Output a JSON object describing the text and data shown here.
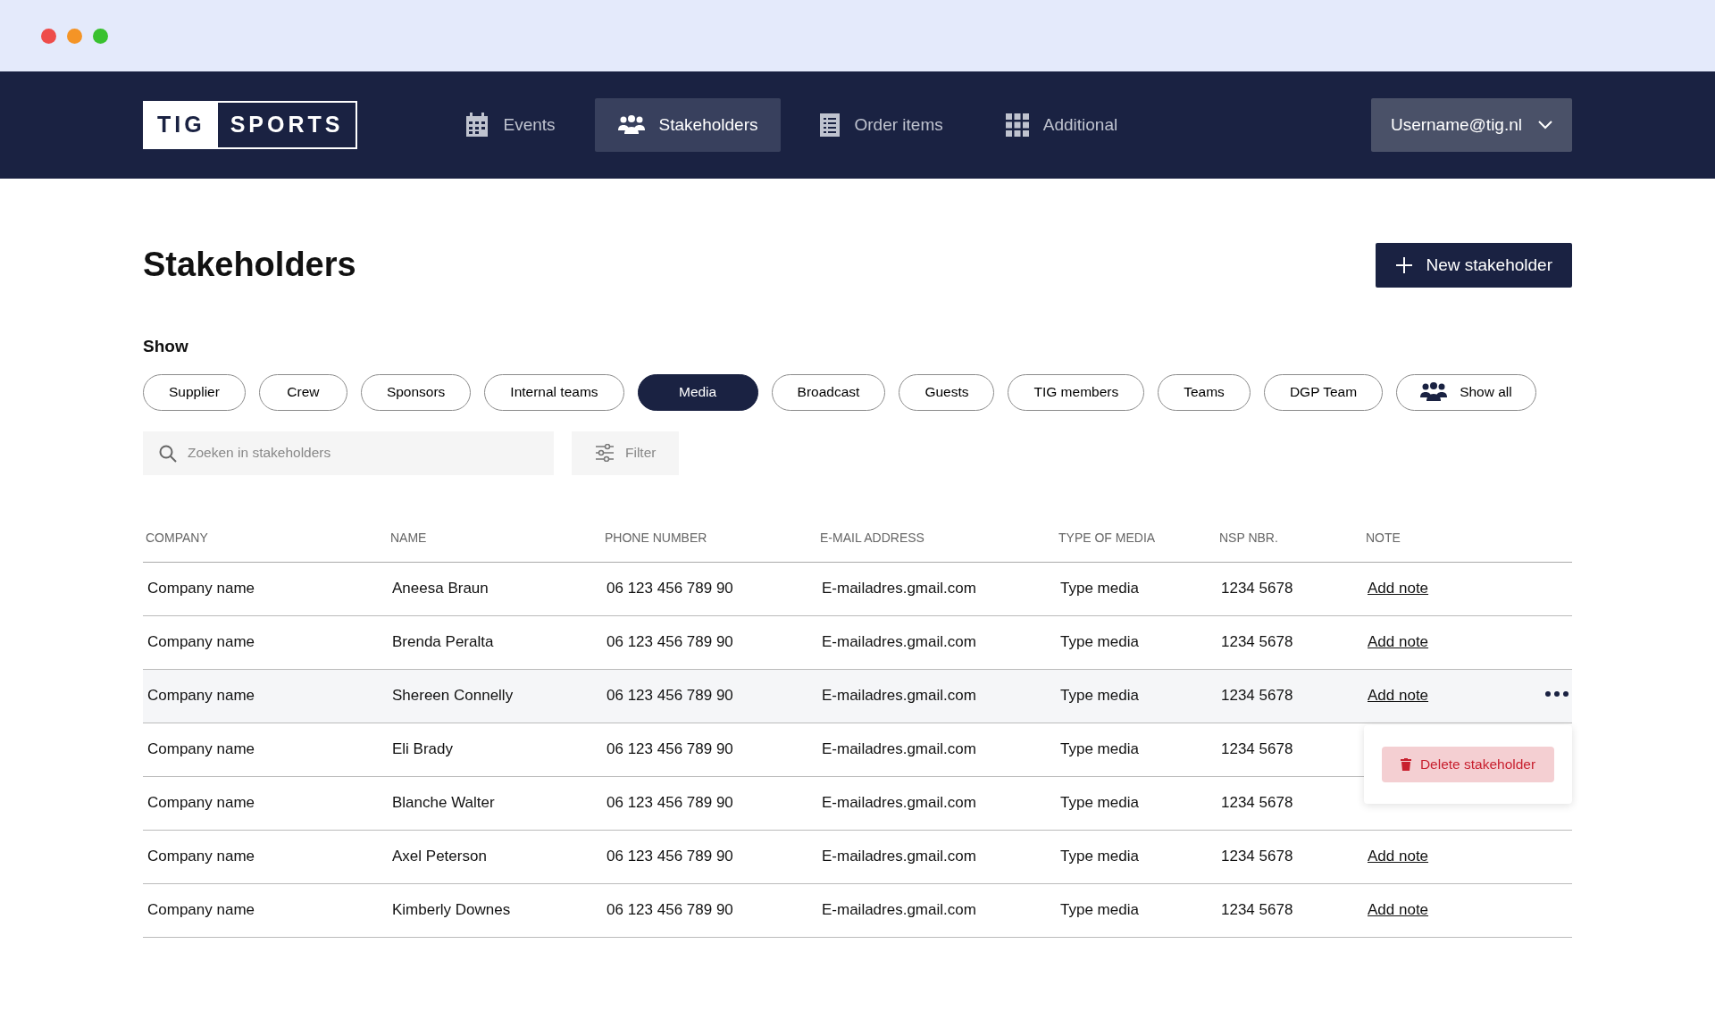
{
  "navbar": {
    "logo": [
      "TIG",
      "SPORTS"
    ],
    "items": [
      {
        "label": "Events",
        "selected": false
      },
      {
        "label": "Stakeholders",
        "selected": true
      },
      {
        "label": "Order items",
        "selected": false
      },
      {
        "label": "Additional",
        "selected": false
      }
    ],
    "user": "Username@tig.nl"
  },
  "page": {
    "title": "Stakeholders",
    "new_button": "New stakeholder"
  },
  "filters": {
    "label": "Show",
    "chips": [
      {
        "label": "Supplier",
        "selected": false,
        "kind": "plain"
      },
      {
        "label": "Crew",
        "selected": false,
        "kind": "plain"
      },
      {
        "label": "Sponsors",
        "selected": false,
        "kind": "plain"
      },
      {
        "label": "Internal teams",
        "selected": false,
        "kind": "plain"
      },
      {
        "label": "Media",
        "selected": true,
        "kind": "plain"
      },
      {
        "label": "Broadcast",
        "selected": false,
        "kind": "plain"
      },
      {
        "label": "Guests",
        "selected": false,
        "kind": "plain"
      },
      {
        "label": "TIG members",
        "selected": false,
        "kind": "plain"
      },
      {
        "label": "Teams",
        "selected": false,
        "kind": "plain"
      },
      {
        "label": "DGP Team",
        "selected": false,
        "kind": "plain"
      },
      {
        "label": "Show all",
        "selected": false,
        "kind": "all"
      }
    ],
    "search": {
      "placeholder": "Zoeken in stakeholders"
    },
    "filter_button": "Filter"
  },
  "table": {
    "columns": [
      "COMPANY",
      "NAME",
      "PHONE NUMBER",
      "E-MAIL ADDRESS",
      "TYPE OF MEDIA",
      "NSP NBR.",
      "NOTE"
    ],
    "rows": [
      {
        "cells": [
          "Company name",
          "Aneesa Braun",
          "06 123 456 789 90",
          "E-mailadres.gmail.com",
          "Type media",
          "1234 5678",
          "Add note"
        ]
      },
      {
        "cells": [
          "Company name",
          "Brenda Peralta",
          "06 123 456 789 90",
          "E-mailadres.gmail.com",
          "Type media",
          "1234 5678",
          "Add note"
        ]
      },
      {
        "cells": [
          "Company name",
          "Shereen Connelly",
          "06 123 456 789 90",
          "E-mailadres.gmail.com",
          "Type media",
          "1234 5678",
          "Add note"
        ],
        "menu": [
          {
            "label": "Delete stakeholder",
            "kind": "danger"
          }
        ]
      },
      {
        "cells": [
          "Company name",
          "Eli Brady",
          "06 123 456 789 90",
          "E-mailadres.gmail.com",
          "Type media",
          "1234 5678"
        ]
      },
      {
        "cells": [
          "Company name",
          "Blanche Walter",
          "06 123 456 789 90",
          "E-mailadres.gmail.com",
          "Type media",
          "1234 5678"
        ]
      },
      {
        "cells": [
          "Company name",
          "Axel Peterson",
          "06 123 456 789 90",
          "E-mailadres.gmail.com",
          "Type media",
          "1234 5678",
          "Add note"
        ]
      },
      {
        "cells": [
          "Company name",
          "Kimberly Downes",
          "06 123 456 789 90",
          "E-mailadres.gmail.com",
          "Type media",
          "1234 5678",
          "Add note"
        ]
      }
    ]
  }
}
